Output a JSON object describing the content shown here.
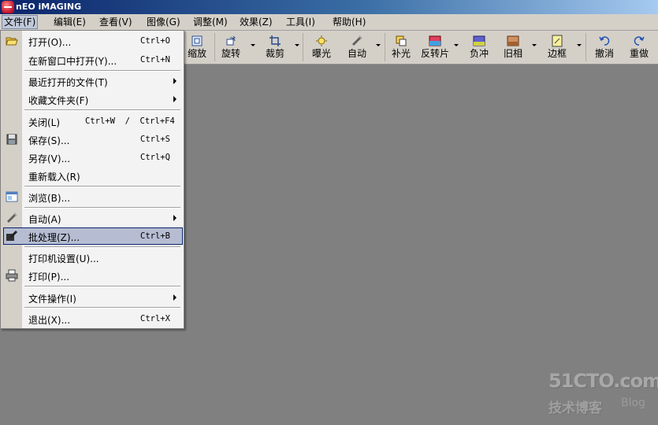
{
  "window": {
    "title": "nEO iMAGING"
  },
  "menubar": {
    "items": [
      "文件(F)",
      "编辑(E)",
      "查看(V)",
      "图像(G)",
      "调整(M)",
      "效果(Z)",
      "工具(I)",
      "帮助(H)"
    ]
  },
  "toolbar": {
    "buttons": [
      "缩放",
      "旋转",
      "裁剪",
      "曝光",
      "自动",
      "补光",
      "反转片",
      "负冲",
      "旧相",
      "边框",
      "撤消",
      "重做"
    ]
  },
  "file_menu": {
    "items": [
      {
        "label": "打开(O)...",
        "shortcut": "Ctrl+O",
        "icon": "open-folder-icon"
      },
      {
        "label": "在新窗口中打开(Y)...",
        "shortcut": "Ctrl+N"
      },
      {
        "label": "最近打开的文件(T)",
        "submenu": true
      },
      {
        "label": "收藏文件夹(F)",
        "submenu": true
      },
      {
        "label": "关闭(L)",
        "shortcut": "Ctrl+W  /  Ctrl+F4"
      },
      {
        "label": "保存(S)...",
        "shortcut": "Ctrl+S",
        "icon": "save-disk-icon"
      },
      {
        "label": "另存(V)...",
        "shortcut": "Ctrl+Q"
      },
      {
        "label": "重新载入(R)"
      },
      {
        "label": "浏览(B)...",
        "icon": "browse-window-icon"
      },
      {
        "label": "自动(A)",
        "submenu": true,
        "icon": "auto-wand-icon"
      },
      {
        "label": "批处理(Z)...",
        "shortcut": "Ctrl+B",
        "icon": "batch-icon",
        "highlighted": true
      },
      {
        "label": "打印机设置(U)..."
      },
      {
        "label": "打印(P)...",
        "icon": "printer-icon"
      },
      {
        "label": "文件操作(I)",
        "submenu": true
      },
      {
        "label": "退出(X)...",
        "shortcut": "Ctrl+X"
      }
    ]
  },
  "watermark": {
    "site": "51CTO.com",
    "sub": "技术博客",
    "blog": "Blog"
  }
}
